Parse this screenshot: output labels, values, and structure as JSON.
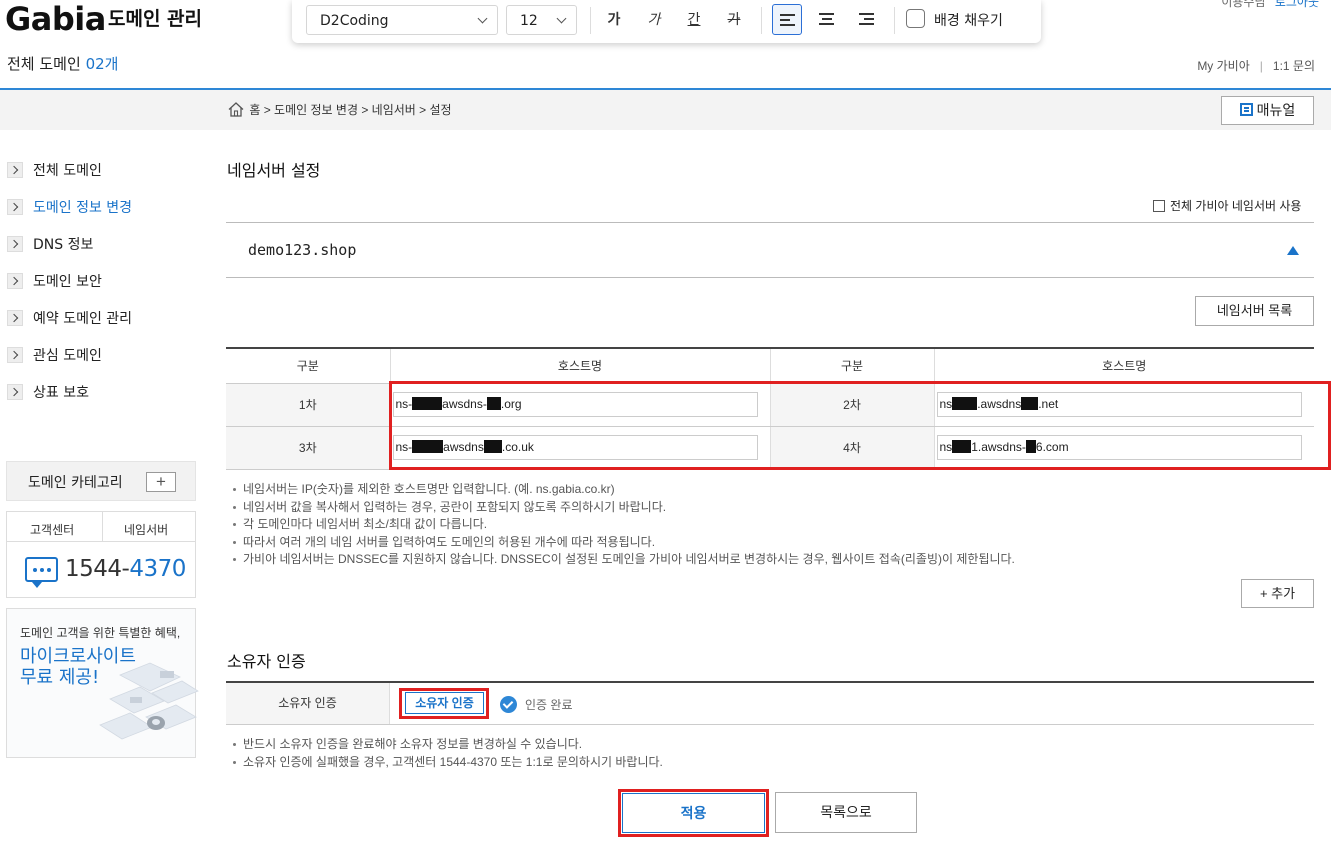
{
  "header": {
    "logo": "Gabia",
    "logo_sub": "도메인 관리",
    "count_label": "전체 도메인",
    "count_value": "02개",
    "top_right_user": "이용수님",
    "top_right_logout": "로그아웃",
    "util_mypage": "My 가비아",
    "util_inquiry": "1:1 문의"
  },
  "toolbar": {
    "font_family": "D2Coding",
    "font_size": "12",
    "bold_label": "가",
    "italic_label": "가",
    "underline_label": "간",
    "strike_label": "가",
    "active_alignment": "left",
    "fill_label": "배경 채우기"
  },
  "breadcrumb": {
    "text": "홈 > 도메인 정보 변경 > 네임서버 > 설정",
    "manual_label": "매뉴얼"
  },
  "sidebar": {
    "items": [
      {
        "label": "전체 도메인"
      },
      {
        "label": "도메인 정보 변경"
      },
      {
        "label": "DNS 정보"
      },
      {
        "label": "도메인 보안"
      },
      {
        "label": "예약 도메인 관리"
      },
      {
        "label": "관심 도메인"
      },
      {
        "label": "상표 보호"
      }
    ],
    "active_index": 1,
    "category_label": "도메인 카테고리",
    "category_add": "+",
    "support_tabs": [
      "고객센터",
      "네임서버"
    ],
    "phone_prefix": "1544-",
    "phone_suffix": "4370",
    "promo_small": "도메인 고객을 위한 특별한 혜택,",
    "promo_big_1": "마이크로사이트",
    "promo_big_2": "무료 제공!"
  },
  "main": {
    "title": "네임서버 설정",
    "all_gabia_label": "전체 가비아 네임서버 사용",
    "domain": "demo123.shop",
    "ns_list_btn": "네임서버 목록",
    "table_headers": [
      "구분",
      "호스트명",
      "구분",
      "호스트명"
    ],
    "rows": [
      {
        "left_label": "1차",
        "left_parts": [
          "ns-",
          "awsdns-",
          ".org"
        ],
        "right_label": "2차",
        "right_parts": [
          "ns",
          ".awsdns",
          ".net"
        ]
      },
      {
        "left_label": "3차",
        "left_parts": [
          "ns-",
          "awsdns",
          ".co.uk"
        ],
        "right_label": "4차",
        "right_parts": [
          "ns",
          "1.awsdns-",
          "6.com"
        ]
      }
    ],
    "notes": [
      "네임서버는 IP(숫자)를 제외한 호스트명만 입력합니다. (예. ns.gabia.co.kr)",
      "네임서버 값을 복사해서 입력하는 경우, 공란이 포함되지 않도록 주의하시기 바랍니다.",
      "각 도메인마다 네임서버 최소/최대 값이 다릅니다.",
      "따라서 여러 개의 네임 서버를 입력하여도 도메인의 허용된 개수에 따라 적용됩니다.",
      "가비아 네임서버는 DNSSEC를 지원하지 않습니다. DNSSEC이 설정된 도메인을 가비아 네임서버로 변경하시는 경우, 웹사이트 접속(리졸빙)이 제한됩니다."
    ],
    "add_btn": "+ 추가"
  },
  "owner": {
    "title": "소유자 인증",
    "label": "소유자 인증",
    "button": "소유자 인증",
    "status": "인증 완료",
    "notes": [
      "반드시 소유자 인증을 완료해야 소유자 정보를 변경하실 수 있습니다.",
      "소유자 인증에 실패했을 경우, 고객센터 1544-4370 또는 1:1로 문의하시기 바랍니다."
    ]
  },
  "actions": {
    "apply": "적용",
    "list": "목록으로"
  },
  "colors": {
    "accent": "#1a73c9",
    "highlight": "#e02020"
  }
}
